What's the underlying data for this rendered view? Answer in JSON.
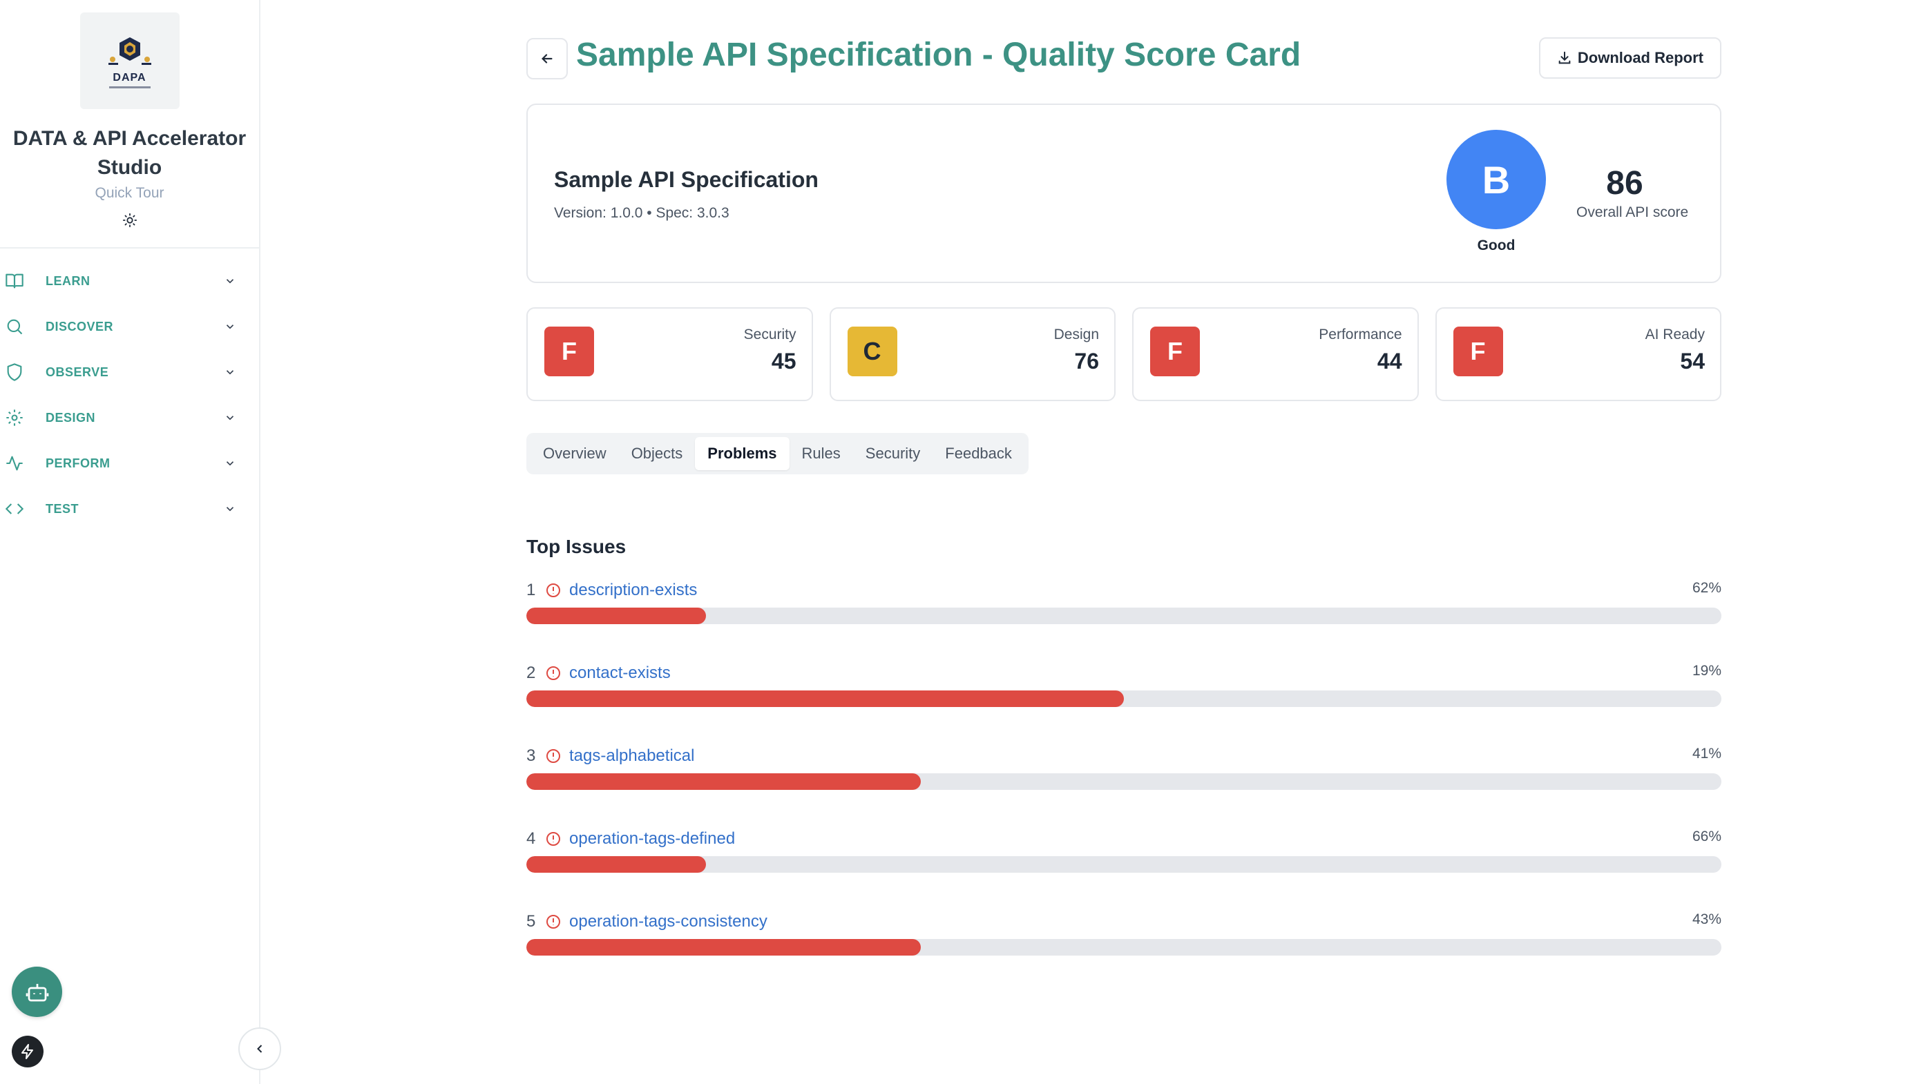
{
  "sidebar": {
    "logo_text": "DAPA",
    "title": "DATA & API Accelerator Studio",
    "subtitle": "Quick Tour",
    "items": [
      {
        "label": "LEARN",
        "icon": "book-icon"
      },
      {
        "label": "DISCOVER",
        "icon": "search-icon"
      },
      {
        "label": "OBSERVE",
        "icon": "shield-icon"
      },
      {
        "label": "DESIGN",
        "icon": "gear-icon"
      },
      {
        "label": "PERFORM",
        "icon": "activity-icon"
      },
      {
        "label": "TEST",
        "icon": "code-icon"
      }
    ]
  },
  "header": {
    "title": "Sample API Specification - Quality Score Card",
    "download_label": "Download Report"
  },
  "summary": {
    "spec_name": "Sample API Specification",
    "meta": "Version: 1.0.0 • Spec: 3.0.3",
    "grade": "B",
    "grade_label": "Good",
    "overall_score": "86",
    "overall_label": "Overall API score"
  },
  "metrics": [
    {
      "name": "Security",
      "grade": "F",
      "value": "45",
      "color": "#de4a42"
    },
    {
      "name": "Design",
      "grade": "C",
      "value": "76",
      "color": "#e6b835"
    },
    {
      "name": "Performance",
      "grade": "F",
      "value": "44",
      "color": "#de4a42"
    },
    {
      "name": "AI Ready",
      "grade": "F",
      "value": "54",
      "color": "#de4a42"
    }
  ],
  "tabs": [
    {
      "label": "Overview",
      "active": false
    },
    {
      "label": "Objects",
      "active": false
    },
    {
      "label": "Problems",
      "active": true
    },
    {
      "label": "Rules",
      "active": false
    },
    {
      "label": "Security",
      "active": false
    },
    {
      "label": "Feedback",
      "active": false
    }
  ],
  "issues": {
    "title": "Top Issues",
    "items": [
      {
        "rank": "1",
        "name": "description-exists",
        "pct": "62%",
        "fill": 0.15
      },
      {
        "rank": "2",
        "name": "contact-exists",
        "pct": "19%",
        "fill": 0.5
      },
      {
        "rank": "3",
        "name": "tags-alphabetical",
        "pct": "41%",
        "fill": 0.33
      },
      {
        "rank": "4",
        "name": "operation-tags-defined",
        "pct": "66%",
        "fill": 0.15
      },
      {
        "rank": "5",
        "name": "operation-tags-consistency",
        "pct": "43%",
        "fill": 0.33
      }
    ]
  },
  "colors": {
    "accent": "#3d9284",
    "grade_b": "#4285f4",
    "danger": "#de4a42",
    "warning": "#e6b835",
    "link": "#3370c9"
  }
}
